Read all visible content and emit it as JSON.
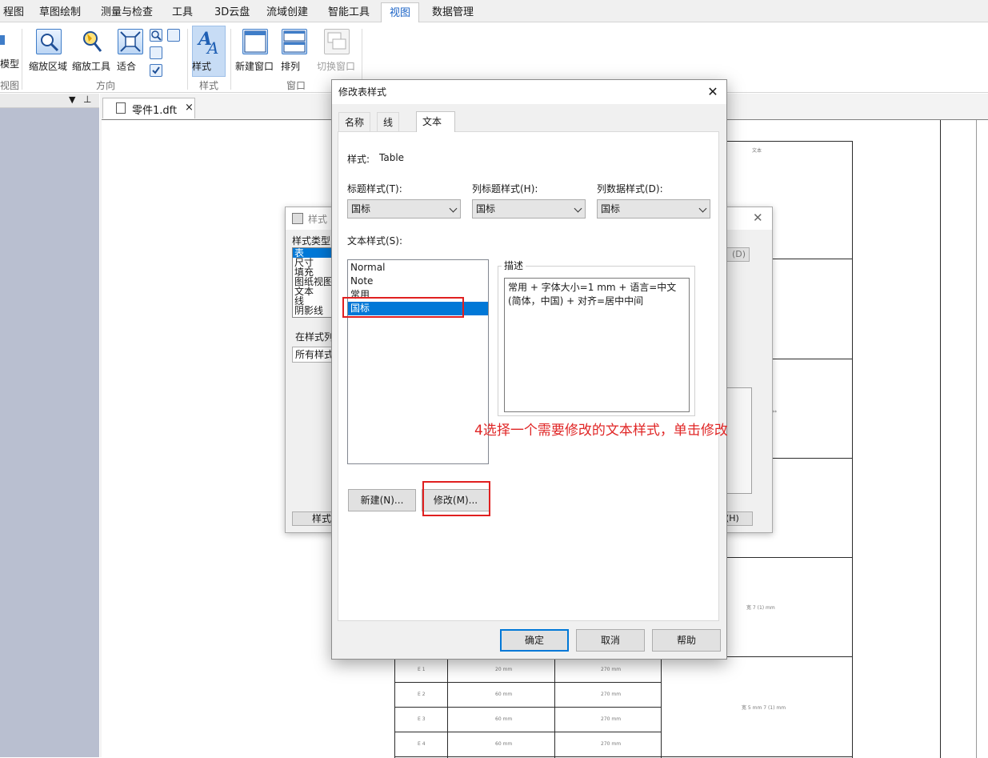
{
  "ribbon": {
    "tabs": [
      {
        "label": "程图",
        "active": false
      },
      {
        "label": "草图绘制",
        "active": false
      },
      {
        "label": "测量与检查",
        "active": false
      },
      {
        "label": "工具",
        "active": false
      },
      {
        "label": "3D云盘",
        "active": false
      },
      {
        "label": "流域创建",
        "active": false
      },
      {
        "label": "智能工具",
        "active": false
      },
      {
        "label": "视图",
        "active": true
      },
      {
        "label": "数据管理",
        "active": false
      }
    ],
    "left_cut": {
      "line1": "模型",
      "group": "视图"
    },
    "buttons": {
      "zoom_area": "缩放区域",
      "zoom_tool": "缩放工具",
      "fit": "适合",
      "style": "样式",
      "new_window": "新建窗口",
      "arrange": "排列",
      "switch_window": "切换窗口"
    },
    "groups": {
      "direction": "方向",
      "style": "样式",
      "window": "窗口"
    }
  },
  "document": {
    "tab_label": "零件1.dft",
    "tab_close": "×"
  },
  "drawing_labels": {
    "top": "文本",
    "mid1": "宽 7 (1) mm",
    "mid2": "宽 5 mm 7 (1) mm",
    "side": "**",
    "rows": [
      {
        "id": "E 1",
        "c2": "20 mm",
        "c3": "270 mm"
      },
      {
        "id": "E 2",
        "c2": "60 mm",
        "c3": "270 mm"
      },
      {
        "id": "E 3",
        "c2": "60 mm",
        "c3": "270 mm"
      },
      {
        "id": "E 4",
        "c2": "60 mm",
        "c3": "270 mm"
      }
    ]
  },
  "bg_dialog": {
    "title": "样式",
    "style_type_label": "样式类型",
    "style_types": [
      "表",
      "尺寸",
      "填充",
      "图纸视图",
      "文本",
      "线",
      "阴影线"
    ],
    "in_list_label": "在样式列",
    "list_filter": "所有样式",
    "right_button": "(D)",
    "bottom_left_button": "样式",
    "bottom_right_button": "g(H)"
  },
  "dialog": {
    "title": "修改表样式",
    "close": "✕",
    "tabs": [
      {
        "label": "名称",
        "active": false
      },
      {
        "label": "线",
        "active": false
      },
      {
        "label": "文本",
        "active": true
      }
    ],
    "style_label": "样式:",
    "style_value": "Table",
    "title_style_label": "标题样式(T):",
    "title_style_value": "国标",
    "col_title_style_label": "列标题样式(H):",
    "col_title_style_value": "国标",
    "col_data_style_label": "列数据样式(D):",
    "col_data_style_value": "国标",
    "text_styles_label": "文本样式(S):",
    "text_styles": [
      {
        "label": "Normal",
        "selected": false
      },
      {
        "label": "Note",
        "selected": false
      },
      {
        "label": "常用",
        "selected": false
      },
      {
        "label": "国标",
        "selected": true
      }
    ],
    "desc_label": "描述",
    "desc_text": "常用 + 字体大小=1 mm + 语言=中文(简体，中国) + 对齐=居中中间",
    "new_button": "新建(N)...",
    "modify_button": "修改(M)...",
    "ok_button": "确定",
    "cancel_button": "取消",
    "help_button": "帮助"
  },
  "annotation": "4选择一个需要修改的文本样式，单击修改",
  "colors": {
    "selection": "#0078d7",
    "annotation": "#e02626",
    "accent_tab": "#1b63c6"
  }
}
